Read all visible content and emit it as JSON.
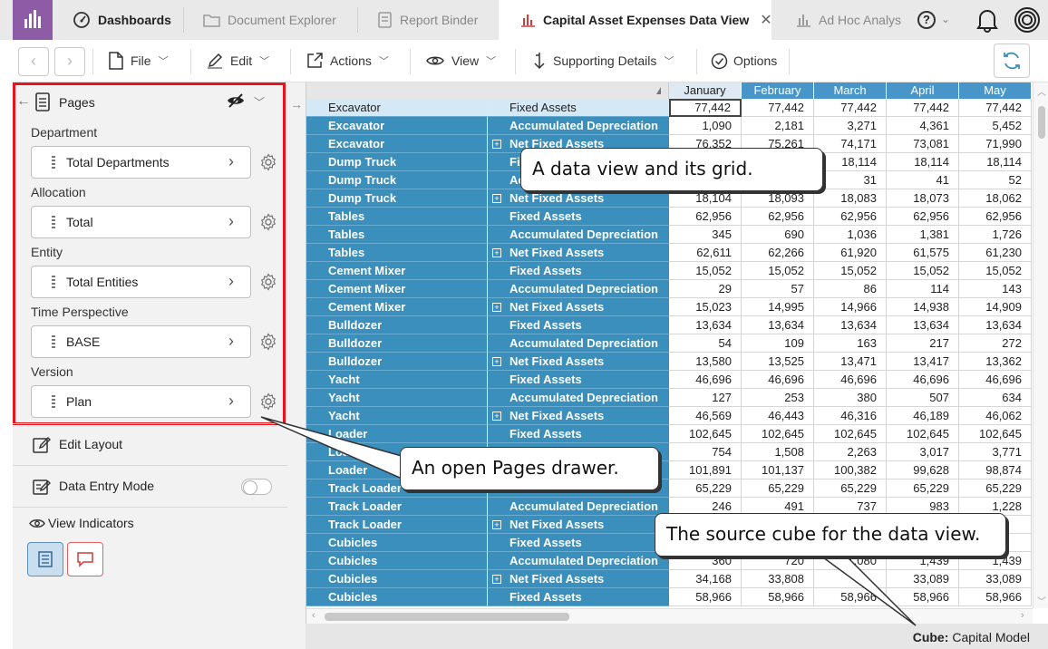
{
  "tabs": {
    "dashboards": "Dashboards",
    "document_explorer": "Document Explorer",
    "report_binder": "Report Binder",
    "active": "Capital Asset Expenses Data View",
    "adhoc": "Ad Hoc Analys",
    "help": "?"
  },
  "toolbar": {
    "file": "File",
    "edit": "Edit",
    "actions": "Actions",
    "view": "View",
    "supporting": "Supporting Details",
    "options": "Options"
  },
  "pages": {
    "title": "Pages",
    "dimensions": [
      {
        "label": "Department",
        "value": "Total Departments"
      },
      {
        "label": "Allocation",
        "value": "Total"
      },
      {
        "label": "Entity",
        "value": "Total Entities"
      },
      {
        "label": "Time Perspective",
        "value": "BASE"
      },
      {
        "label": "Version",
        "value": "Plan"
      }
    ]
  },
  "left_menu": {
    "edit_layout": "Edit Layout",
    "data_entry_mode": "Data Entry Mode",
    "data_entry_on": false,
    "view_indicators": "View Indicators"
  },
  "grid": {
    "months": [
      "January",
      "February",
      "March",
      "April",
      "May"
    ],
    "rows": [
      {
        "asset": "Excavator",
        "account": "Fixed Assets",
        "exp": false,
        "vals": [
          "77,442",
          "77,442",
          "77,442",
          "77,442",
          "77,442"
        ]
      },
      {
        "asset": "Excavator",
        "account": "Accumulated Depreciation",
        "exp": false,
        "vals": [
          "1,090",
          "2,181",
          "3,271",
          "4,361",
          "5,452"
        ]
      },
      {
        "asset": "Excavator",
        "account": "Net Fixed Assets",
        "exp": true,
        "vals": [
          "76,352",
          "75,261",
          "74,171",
          "73,081",
          "71,990"
        ]
      },
      {
        "asset": "Dump Truck",
        "account": "Fixed Assets",
        "exp": false,
        "vals": [
          "",
          "",
          "18,114",
          "18,114",
          "18,114"
        ]
      },
      {
        "asset": "Dump Truck",
        "account": "Accumulated Depreciation",
        "exp": false,
        "vals": [
          "",
          "",
          "31",
          "41",
          "52"
        ]
      },
      {
        "asset": "Dump Truck",
        "account": "Net Fixed Assets",
        "exp": true,
        "vals": [
          "18,104",
          "18,093",
          "18,083",
          "18,073",
          "18,062"
        ]
      },
      {
        "asset": "Tables",
        "account": "Fixed Assets",
        "exp": false,
        "vals": [
          "62,956",
          "62,956",
          "62,956",
          "62,956",
          "62,956"
        ]
      },
      {
        "asset": "Tables",
        "account": "Accumulated Depreciation",
        "exp": false,
        "vals": [
          "345",
          "690",
          "1,036",
          "1,381",
          "1,726"
        ]
      },
      {
        "asset": "Tables",
        "account": "Net Fixed Assets",
        "exp": true,
        "vals": [
          "62,611",
          "62,266",
          "61,920",
          "61,575",
          "61,230"
        ]
      },
      {
        "asset": "Cement Mixer",
        "account": "Fixed Assets",
        "exp": false,
        "vals": [
          "15,052",
          "15,052",
          "15,052",
          "15,052",
          "15,052"
        ]
      },
      {
        "asset": "Cement Mixer",
        "account": "Accumulated Depreciation",
        "exp": false,
        "vals": [
          "29",
          "57",
          "86",
          "114",
          "143"
        ]
      },
      {
        "asset": "Cement Mixer",
        "account": "Net Fixed Assets",
        "exp": true,
        "vals": [
          "15,023",
          "14,995",
          "14,966",
          "14,938",
          "14,909"
        ]
      },
      {
        "asset": "Bulldozer",
        "account": "Fixed Assets",
        "exp": false,
        "vals": [
          "13,634",
          "13,634",
          "13,634",
          "13,634",
          "13,634"
        ]
      },
      {
        "asset": "Bulldozer",
        "account": "Accumulated Depreciation",
        "exp": false,
        "vals": [
          "54",
          "109",
          "163",
          "217",
          "272"
        ]
      },
      {
        "asset": "Bulldozer",
        "account": "Net Fixed Assets",
        "exp": true,
        "vals": [
          "13,580",
          "13,525",
          "13,471",
          "13,417",
          "13,362"
        ]
      },
      {
        "asset": "Yacht",
        "account": "Fixed Assets",
        "exp": false,
        "vals": [
          "46,696",
          "46,696",
          "46,696",
          "46,696",
          "46,696"
        ]
      },
      {
        "asset": "Yacht",
        "account": "Accumulated Depreciation",
        "exp": false,
        "vals": [
          "127",
          "253",
          "380",
          "507",
          "634"
        ]
      },
      {
        "asset": "Yacht",
        "account": "Net Fixed Assets",
        "exp": true,
        "vals": [
          "46,569",
          "46,443",
          "46,316",
          "46,189",
          "46,062"
        ]
      },
      {
        "asset": "Loader",
        "account": "Fixed Assets",
        "exp": false,
        "vals": [
          "102,645",
          "102,645",
          "102,645",
          "102,645",
          "102,645"
        ]
      },
      {
        "asset": "Loader",
        "account": "",
        "exp": false,
        "vals": [
          "754",
          "1,508",
          "2,263",
          "3,017",
          "3,771"
        ]
      },
      {
        "asset": "Loader",
        "account": "",
        "exp": false,
        "vals": [
          "101,891",
          "101,137",
          "100,382",
          "99,628",
          "98,874"
        ]
      },
      {
        "asset": "Track Loader",
        "account": "",
        "exp": false,
        "vals": [
          "65,229",
          "65,229",
          "65,229",
          "65,229",
          "65,229"
        ]
      },
      {
        "asset": "Track Loader",
        "account": "Accumulated Depreciation",
        "exp": false,
        "vals": [
          "246",
          "491",
          "737",
          "983",
          "1,228"
        ]
      },
      {
        "asset": "Track Loader",
        "account": "Net Fixed Assets",
        "exp": true,
        "vals": [
          "",
          "",
          "",
          "",
          ""
        ]
      },
      {
        "asset": "Cubicles",
        "account": "Fixed Assets",
        "exp": false,
        "vals": [
          "",
          "",
          "",
          "",
          ""
        ]
      },
      {
        "asset": "Cubicles",
        "account": "Accumulated Depreciation",
        "exp": false,
        "vals": [
          "360",
          "720",
          "1,080",
          "1,439",
          "1,439"
        ]
      },
      {
        "asset": "Cubicles",
        "account": "Net Fixed Assets",
        "exp": true,
        "vals": [
          "34,168",
          "33,808",
          "",
          "33,089",
          "33,089"
        ]
      },
      {
        "asset": "Cubicles",
        "account": "Fixed Assets",
        "exp": false,
        "vals": [
          "58,966",
          "58,966",
          "58,966",
          "58,966",
          "58,966"
        ]
      }
    ]
  },
  "status": {
    "cube_label": "Cube:",
    "cube_value": "Capital Model"
  },
  "callouts": {
    "grid": "A data view and its grid.",
    "drawer": "An open Pages drawer.",
    "cube": "The source cube for the data view."
  }
}
